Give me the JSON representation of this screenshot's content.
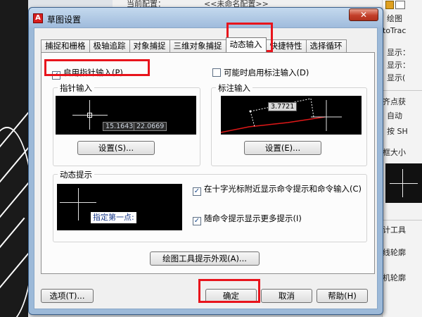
{
  "background": {
    "top_labels": [
      "当前配置：",
      "<<未命名配置>>"
    ],
    "right_panel": [
      "绘图",
      "toTrac",
      "显示：",
      "显示：",
      "显示(",
      "齐点获",
      "自动",
      "按 SH",
      "框大小",
      "计工具",
      "线轮廓",
      "机轮廓"
    ]
  },
  "dialog": {
    "title": "草图设置",
    "close_glyph": "✕",
    "tabs": [
      "捕捉和栅格",
      "极轴追踪",
      "对象捕捉",
      "三维对象捕捉",
      "动态输入",
      "快捷特性",
      "选择循环"
    ],
    "active_tab_index": 4,
    "pointer_input": {
      "enable_label": "启用指针输入(P)",
      "enabled": true,
      "group_title": "指针输入",
      "coord1": "15.1643",
      "coord2": "22.0669",
      "settings_button": "设置(S)..."
    },
    "dimension_input": {
      "enable_label": "可能时启用标注输入(D)",
      "enabled": false,
      "group_title": "标注输入",
      "dim_value": "3.7721",
      "settings_button": "设置(E)..."
    },
    "dynamic_prompt": {
      "group_title": "动态提示",
      "prompt_text": "指定第一点:",
      "option1_label": "在十字光标附近显示命令提示和命令输入(C)",
      "option1_checked": true,
      "option2_label": "随命令提示显示更多提示(I)",
      "option2_checked": true
    },
    "appearance_button": "绘图工具提示外观(A)...",
    "options_button": "选项(T)...",
    "ok_button": "确定",
    "cancel_button": "取消",
    "help_button": "帮助(H)",
    "checkmark_glyph": "✓",
    "highlight_color": "#e8141c"
  }
}
